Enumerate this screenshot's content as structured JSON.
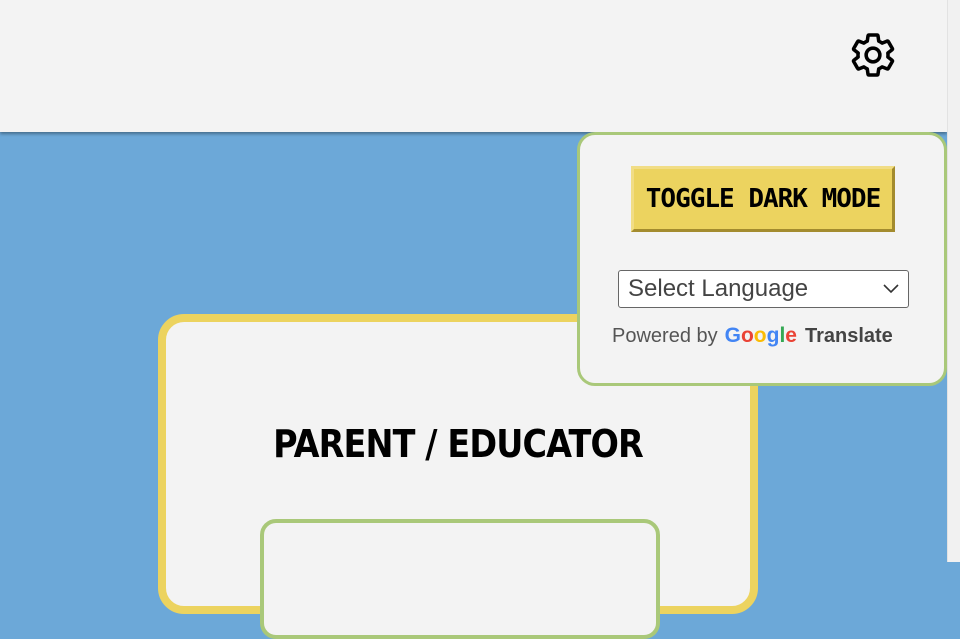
{
  "header": {
    "settings_icon": "gear-icon"
  },
  "settings": {
    "toggle_dark_mode_label": "TOGGLE DARK MODE",
    "language_select": {
      "selected": "Select Language",
      "icon": "chevron-down-icon"
    },
    "powered_by": {
      "prefix": "Powered by",
      "brand": [
        "G",
        "o",
        "o",
        "g",
        "l",
        "e"
      ],
      "suffix": "Translate"
    }
  },
  "main": {
    "card_title": "PARENT / EDUCATOR"
  },
  "colors": {
    "background": "#6ca8d8",
    "header_bg": "#f3f3f3",
    "card_border": "#ecd35f",
    "panel_border": "#a9c879",
    "button_bg": "#ecd35f"
  }
}
